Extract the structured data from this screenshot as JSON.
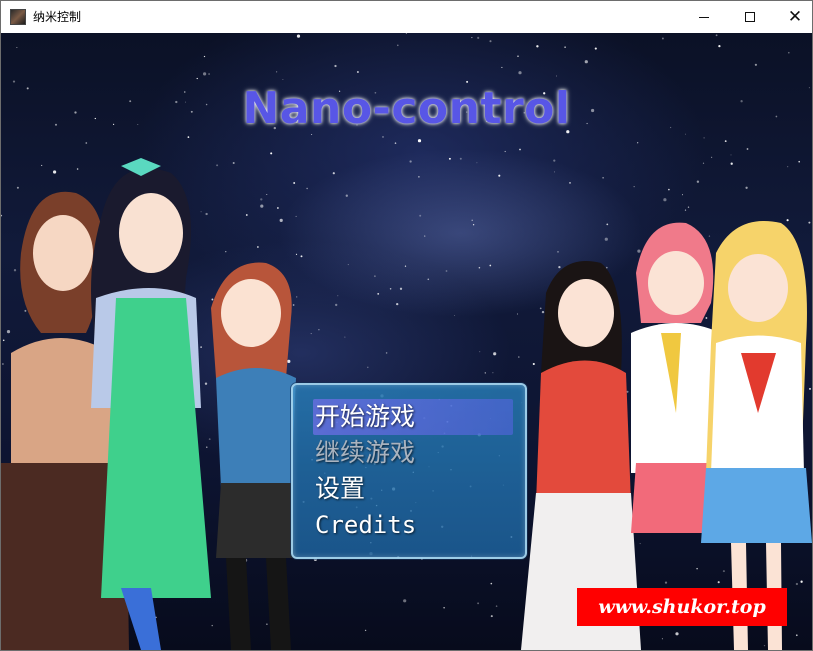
{
  "window": {
    "title": "纳米控制",
    "controls": {
      "minimize": "minimize",
      "maximize": "maximize",
      "close": "✕"
    }
  },
  "game": {
    "title": "Nano-control",
    "menu": {
      "items": [
        {
          "label": "开始游戏",
          "selected": true,
          "enabled": true
        },
        {
          "label": "继续游戏",
          "selected": false,
          "enabled": false
        },
        {
          "label": "设置",
          "selected": false,
          "enabled": true
        },
        {
          "label": "Credits",
          "selected": false,
          "enabled": true
        }
      ]
    },
    "watermark": "www.shukor.top"
  },
  "colors": {
    "title": "#5856e6",
    "menu_bg": "#2a82be",
    "menu_border": "#aad7f0",
    "cursor": "#6e6ee6",
    "watermark_bg": "#ff0000",
    "space_bg": "#0b1126"
  },
  "icons": [
    "app-icon",
    "minimize-icon",
    "maximize-icon",
    "close-icon"
  ]
}
